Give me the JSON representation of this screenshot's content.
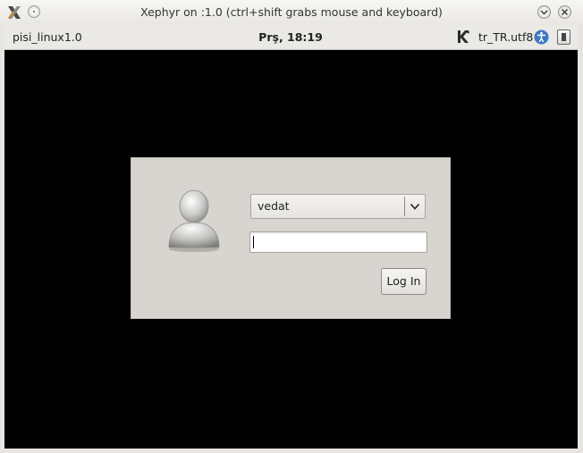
{
  "window": {
    "title": "Xephyr on :1.0 (ctrl+shift grabs mouse and keyboard)",
    "icon": "x-logo-icon",
    "controls": [
      "pin-icon",
      "minimize-icon",
      "close-icon"
    ]
  },
  "panel": {
    "hostname": "pisi_linux1.0",
    "clock": "Prş, 18:19",
    "session_icon": "kde-icon",
    "locale": "tr_TR.utf8",
    "accessibility_icon": "accessibility-icon",
    "power_icon": "battery-icon"
  },
  "login": {
    "avatar_icon": "user-avatar-icon",
    "user_select": {
      "value": "vedat",
      "dropdown_icon": "chevron-down-icon"
    },
    "password": {
      "value": "",
      "placeholder": ""
    },
    "login_button_label": "Log In"
  },
  "colors": {
    "screen_background": "#000000",
    "login_box": "#d8d5d0",
    "panel_background": "#eae9e6",
    "accent_blue": "#3a78c8"
  }
}
